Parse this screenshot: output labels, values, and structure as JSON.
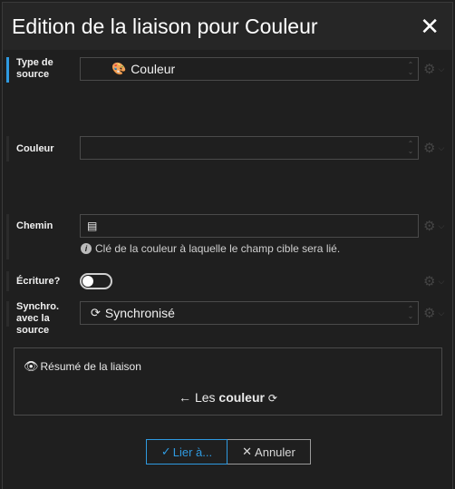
{
  "dialog": {
    "title": "Edition de la liaison pour Couleur",
    "close_label": "✕"
  },
  "rows": {
    "source_type": {
      "label": "Type de source",
      "value": "Couleur",
      "icon": "palette-icon"
    },
    "color": {
      "label": "Couleur",
      "value": ""
    },
    "path": {
      "label": "Chemin",
      "value": "",
      "icon": "list-icon",
      "hint": "Clé de la couleur à laquelle le champ cible sera lié."
    },
    "write": {
      "label": "Écriture?",
      "enabled": false
    },
    "sync": {
      "label": "Synchro. avec la source",
      "value": "Synchronisé",
      "icon": "sync-icon"
    }
  },
  "summary": {
    "title": "Résumé de la liaison",
    "prefix": "Les",
    "bold": "couleur",
    "arrow": "←",
    "sync_glyph": "⟳"
  },
  "buttons": {
    "bind_label": "Lier à...",
    "cancel_label": "Annuler"
  },
  "colors": {
    "accent": "#2f9ae0",
    "background": "#1f1f1f",
    "header": "#262626"
  }
}
